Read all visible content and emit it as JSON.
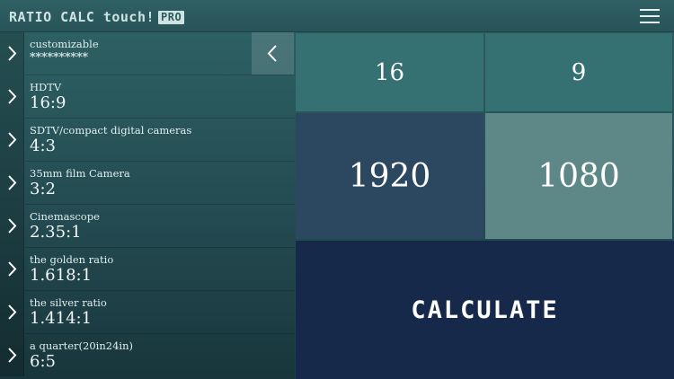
{
  "header": {
    "title": "RATIO CALC touch!",
    "badge": "PRO",
    "menu_icon": "hamburger-menu-icon"
  },
  "presets": [
    {
      "name": "customizable",
      "ratio": "**********"
    },
    {
      "name": "HDTV",
      "ratio": "16:9"
    },
    {
      "name": "SDTV/compact digital cameras",
      "ratio": "4:3"
    },
    {
      "name": "35mm film Camera",
      "ratio": "3:2"
    },
    {
      "name": "Cinemascope",
      "ratio": "2.35:1"
    },
    {
      "name": "the golden ratio",
      "ratio": "1.618:1"
    },
    {
      "name": "the silver ratio",
      "ratio": "1.414:1"
    },
    {
      "name": "a quarter(20in24in)",
      "ratio": "6:5"
    }
  ],
  "calculator": {
    "ratio_width": "16",
    "ratio_height": "9",
    "pixel_width": "1920",
    "pixel_height": "1080",
    "calculate_label": "CALCULATE"
  },
  "colors": {
    "ratio_cells": "#357073",
    "pixel_width_cell": "#2c4760",
    "pixel_height_cell": "#5e8888",
    "calculate_button": "#16294b"
  }
}
